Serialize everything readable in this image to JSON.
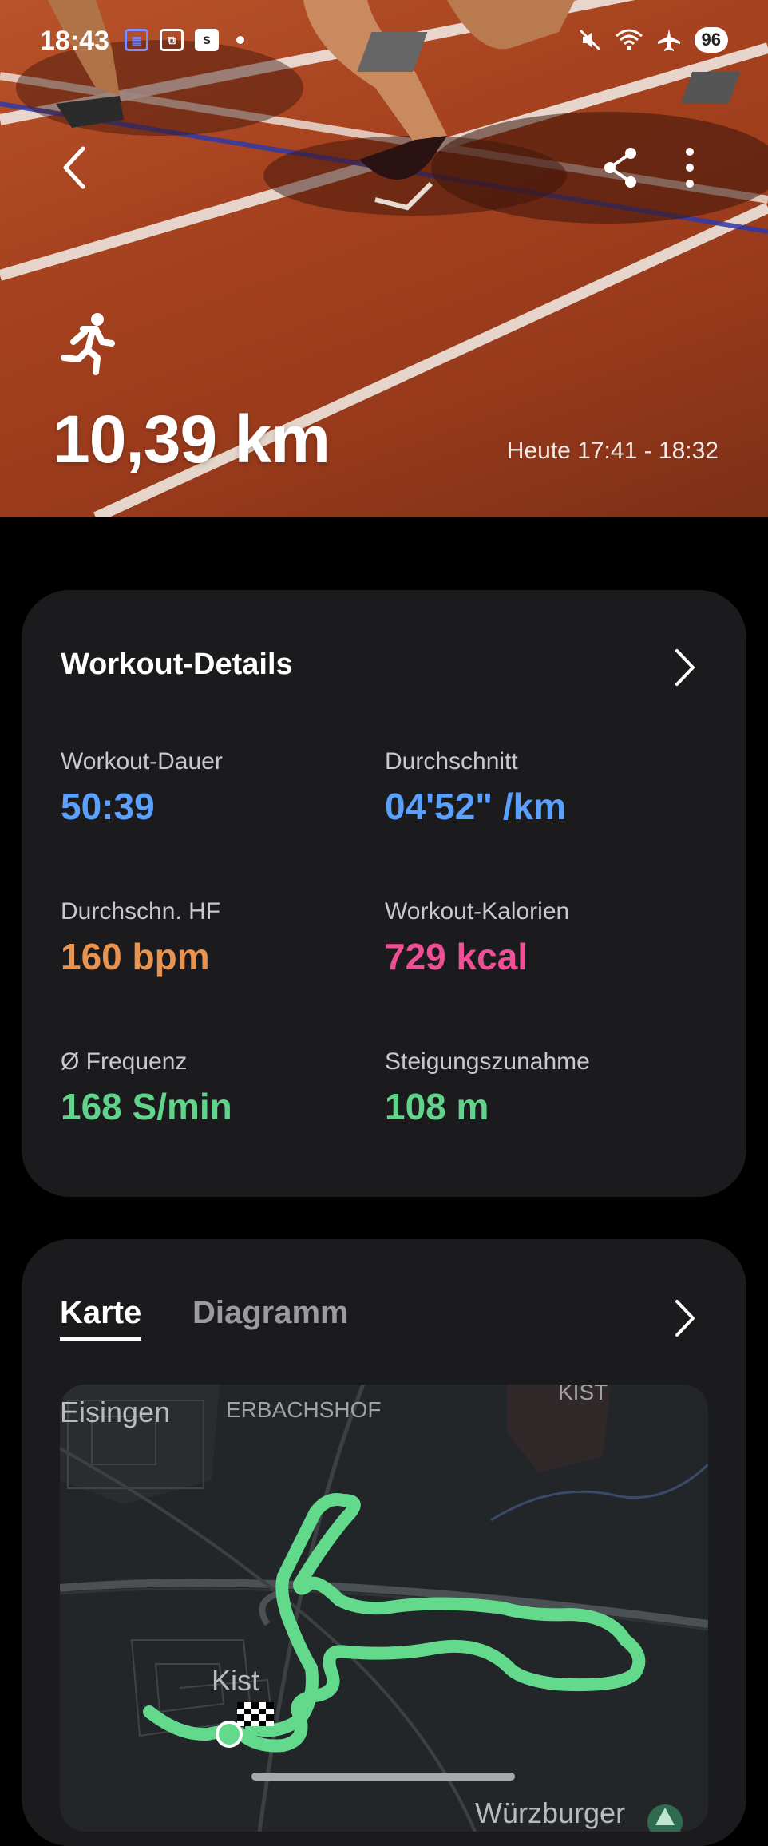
{
  "status_bar": {
    "time": "18:43",
    "battery": "96",
    "left_icons": [
      "gallery-icon",
      "screenshot-icon",
      "s-app-icon",
      "notification-dot"
    ],
    "right_icons": [
      "mute-icon",
      "wifi-icon",
      "airplane-icon",
      "battery-icon"
    ]
  },
  "hero": {
    "distance": "10,39 km",
    "time_range": "Heute 17:41 - 18:32",
    "activity_icon": "running-icon"
  },
  "details": {
    "title": "Workout-Details",
    "metrics": [
      {
        "label": "Workout-Dauer",
        "value": "50:39",
        "color": "#5aa0ff"
      },
      {
        "label": "Durchschnitt",
        "value": "04'52\" /km",
        "color": "#5aa0ff"
      },
      {
        "label": "Durchschn. HF",
        "value": "160 bpm",
        "color": "#e8934f"
      },
      {
        "label": "Workout-Kalorien",
        "value": "729 kcal",
        "color": "#ee4f95"
      },
      {
        "label": "Ø Frequenz",
        "value": "168 S/min",
        "color": "#5fd48a"
      },
      {
        "label": "Steigungszunahme",
        "value": "108 m",
        "color": "#5fd48a"
      }
    ]
  },
  "map_card": {
    "tabs": [
      {
        "label": "Karte",
        "active": true
      },
      {
        "label": "Diagramm",
        "active": false
      }
    ],
    "map_labels": {
      "eisingen": "Eisingen",
      "erbachshof": "ERBACHSHOF",
      "kist_top": "KIST",
      "kist": "Kist",
      "wuerzburger": "Würzburger"
    },
    "route_color": "#63d98c"
  }
}
